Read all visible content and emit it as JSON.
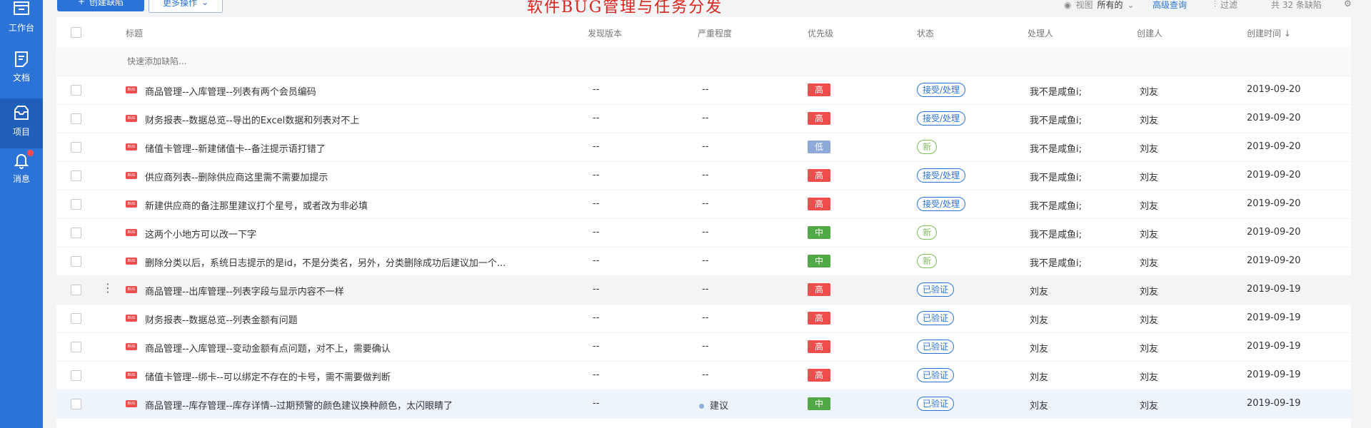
{
  "sidebar": {
    "items": [
      {
        "label": "工作台",
        "icon": "workbench-icon",
        "active": false
      },
      {
        "label": "文档",
        "icon": "document-icon",
        "active": false
      },
      {
        "label": "项目",
        "icon": "project-inbox-icon",
        "active": true
      },
      {
        "label": "消息",
        "icon": "bell-icon",
        "active": false,
        "badge": true
      }
    ]
  },
  "toolbar": {
    "create_label": "创建缺陷",
    "more_label": "更多操作",
    "banner": "软件BUG管理与任务分发",
    "view_label": "视图",
    "view_value": "所有的",
    "advanced_label": "高级查询",
    "filter_label": "过滤",
    "count_label": "共 32 条缺陷"
  },
  "table": {
    "headers": {
      "title": "标题",
      "version": "发现版本",
      "severity": "严重程度",
      "priority": "优先级",
      "status": "状态",
      "handler": "处理人",
      "creator": "创建人",
      "created": "创建时间 ↓"
    },
    "quick_add_placeholder": "快速添加缺陷...",
    "bug_tag": "BUG",
    "rows": [
      {
        "title": "商品管理--入库管理--列表有两个会员编码",
        "version": "--",
        "severity": "--",
        "priority": "高",
        "status": "接受/处理",
        "handler": "我不是咸鱼i;",
        "creator": "刘友",
        "created": "2019-09-20"
      },
      {
        "title": "财务报表--数据总览--导出的Excel数据和列表对不上",
        "version": "--",
        "severity": "--",
        "priority": "高",
        "status": "接受/处理",
        "handler": "我不是咸鱼i;",
        "creator": "刘友",
        "created": "2019-09-20"
      },
      {
        "title": "储值卡管理--新建储值卡--备注提示语打错了",
        "version": "--",
        "severity": "--",
        "priority": "低",
        "status": "新",
        "handler": "我不是咸鱼i;",
        "creator": "刘友",
        "created": "2019-09-20"
      },
      {
        "title": "供应商列表--删除供应商这里需不需要加提示",
        "version": "--",
        "severity": "--",
        "priority": "高",
        "status": "接受/处理",
        "handler": "我不是咸鱼i;",
        "creator": "刘友",
        "created": "2019-09-20"
      },
      {
        "title": "新建供应商的备注那里建议打个星号，或者改为非必填",
        "version": "--",
        "severity": "--",
        "priority": "高",
        "status": "接受/处理",
        "handler": "我不是咸鱼i;",
        "creator": "刘友",
        "created": "2019-09-20"
      },
      {
        "title": "这两个小地方可以改一下字",
        "version": "--",
        "severity": "--",
        "priority": "中",
        "status": "新",
        "handler": "我不是咸鱼i;",
        "creator": "刘友",
        "created": "2019-09-20"
      },
      {
        "title": "删除分类以后，系统日志提示的是id，不是分类名，另外，分类删除成功后建议加一个...",
        "version": "--",
        "severity": "--",
        "priority": "中",
        "status": "新",
        "handler": "我不是咸鱼i;",
        "creator": "刘友",
        "created": "2019-09-20"
      },
      {
        "title": "商品管理--出库管理--列表字段与显示内容不一样",
        "version": "--",
        "severity": "--",
        "priority": "高",
        "status": "已验证",
        "handler": "刘友",
        "creator": "刘友",
        "created": "2019-09-19"
      },
      {
        "title": "财务报表--数据总览--列表金额有问题",
        "version": "--",
        "severity": "--",
        "priority": "高",
        "status": "已验证",
        "handler": "刘友",
        "creator": "刘友",
        "created": "2019-09-19"
      },
      {
        "title": "商品管理--入库管理--变动金额有点问题，对不上，需要确认",
        "version": "--",
        "severity": "--",
        "priority": "高",
        "status": "已验证",
        "handler": "刘友",
        "creator": "刘友",
        "created": "2019-09-19"
      },
      {
        "title": "储值卡管理--绑卡--可以绑定不存在的卡号，需不需要做判断",
        "version": "--",
        "severity": "--",
        "priority": "高",
        "status": "已验证",
        "handler": "刘友",
        "creator": "刘友",
        "created": "2019-09-19"
      },
      {
        "title": "商品管理--库存管理--库存详情--过期预警的颜色建议换种颜色，太闪眼睛了",
        "version": "--",
        "severity": "建议",
        "priority": "中",
        "status": "已验证",
        "handler": "刘友",
        "creator": "刘友",
        "created": "2019-09-19"
      }
    ]
  },
  "colors": {
    "sidebar": "#2b73d7",
    "priority_high": "#ee4d4d",
    "priority_medium": "#52a746",
    "priority_low": "#8ea8d8",
    "status_accept": "#2b73d7",
    "status_new": "#7cbf5b",
    "status_verified": "#2b73d7"
  }
}
